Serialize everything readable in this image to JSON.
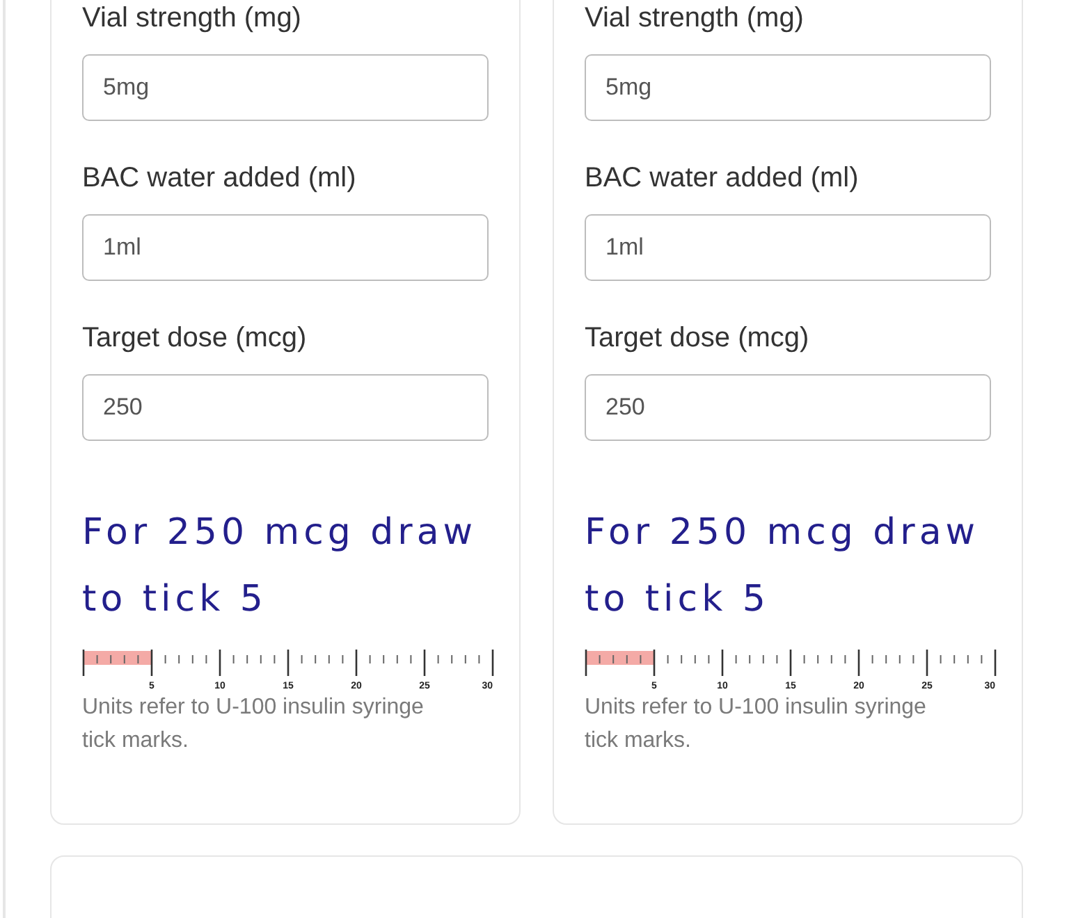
{
  "cards": [
    {
      "fields": [
        {
          "label": "Vial strength (mg)",
          "value": "5mg"
        },
        {
          "label": "BAC water added (ml)",
          "value": "1ml"
        },
        {
          "label": "Target dose (mcg)",
          "value": "250"
        }
      ],
      "result": "For 250 mcg draw to tick 5",
      "scale": {
        "level": 0.1667,
        "ticks": [
          "5",
          "10",
          "15",
          "20",
          "25",
          "30"
        ]
      },
      "note": "Units refer to U-100 insulin syringe tick marks."
    },
    {
      "fields": [
        {
          "label": "Vial strength (mg)",
          "value": "5mg"
        },
        {
          "label": "BAC water added (ml)",
          "value": "1ml"
        },
        {
          "label": "Target dose (mcg)",
          "value": "250"
        }
      ],
      "result": "For 250 mcg draw to tick 5",
      "scale": {
        "level": 0.1667,
        "ticks": [
          "5",
          "10",
          "15",
          "20",
          "25",
          "30"
        ]
      },
      "note": "Units refer to U-100 insulin syringe tick marks."
    }
  ]
}
